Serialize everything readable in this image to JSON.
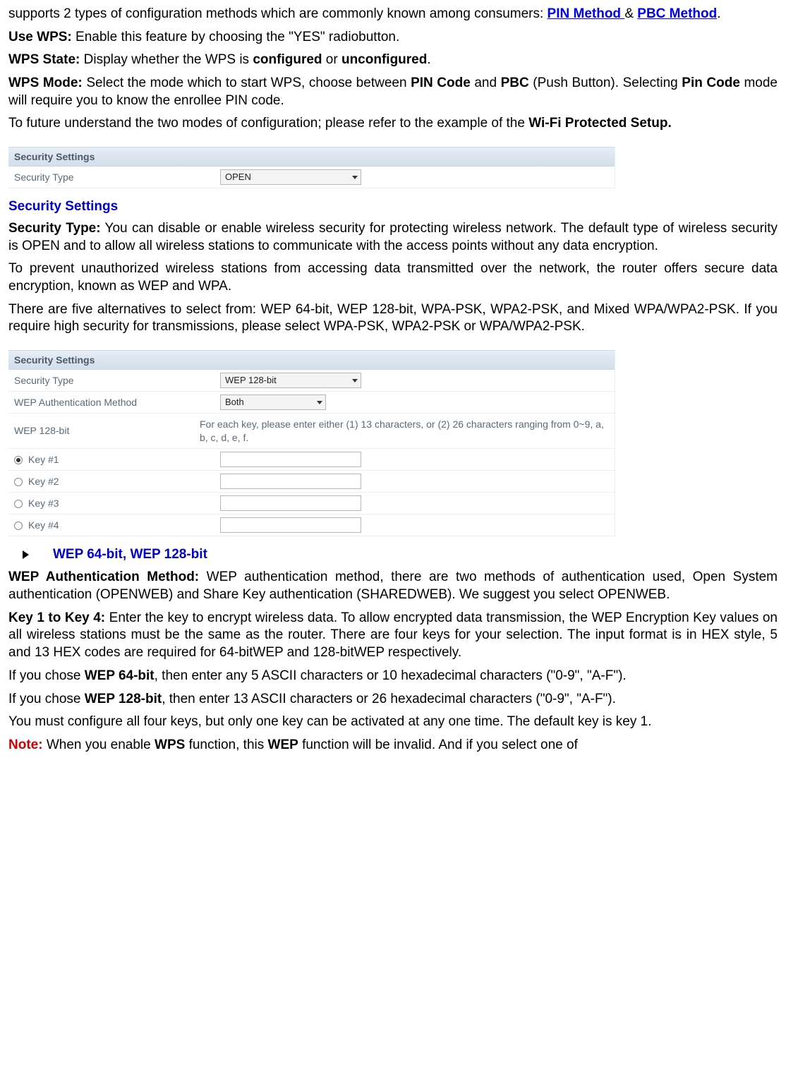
{
  "p1_a": "supports 2 types of configuration methods which are commonly known among consumers: ",
  "link_pin": "PIN Method ",
  "amp": "& ",
  "link_pbc": "PBC Method",
  "p1_end": ".",
  "p2_label": "Use WPS:",
  "p2_text": " Enable this feature by choosing the \"YES\" radiobutton.",
  "p3_label": "WPS State:",
  "p3_a": " Display whether the WPS is ",
  "p3_b": "configured",
  "p3_c": " or ",
  "p3_d": "unconfigured",
  "p3_e": ".",
  "p4_label": "WPS Mode:",
  "p4_a": " Select the mode which to start WPS, choose between ",
  "p4_b": "PIN Code",
  "p4_c": " and ",
  "p4_d": "PBC",
  "p4_e": " (Push Button). Selecting ",
  "p4_f": "Pin Code",
  "p4_g": " mode will require you to know the enrollee PIN code.",
  "p5_a": "To future understand the two modes of configuration; please refer to the example of the ",
  "p5_b": "Wi-Fi Protected Setup.",
  "ss1": {
    "header": "Security Settings",
    "row_label": "Security Type",
    "row_value": "OPEN"
  },
  "sec_title": "Security Settings",
  "sec_label": "Security Type:",
  "sec_text": " You can disable or enable wireless security for protecting wireless network. The default type of wireless security is OPEN and to allow all wireless stations to communicate with the access points without any data encryption.",
  "sec_p2": "To prevent unauthorized wireless stations from accessing data transmitted over the network, the router offers secure data encryption, known as WEP and WPA.",
  "sec_p3": "There are five alternatives to select from: WEP 64-bit, WEP 128-bit, WPA-PSK, WPA2-PSK, and Mixed WPA/WPA2-PSK. If you require high security for transmissions, please select WPA-PSK, WPA2-PSK or WPA/WPA2-PSK.",
  "ss2": {
    "header": "Security Settings",
    "r1_label": "Security Type",
    "r1_value": "WEP 128-bit",
    "r2_label": "WEP Authentication Method",
    "r2_value": "Both",
    "r3_label": "WEP 128-bit",
    "r3_text": "For each key, please enter either (1) 13 characters, or (2) 26 characters ranging from 0~9, a, b, c, d, e, f.",
    "k1": "Key #1",
    "k2": "Key #2",
    "k3": "Key #3",
    "k4": "Key #4"
  },
  "bullet": "WEP 64-bit, WEP 128-bit",
  "wep_auth_label": "WEP Authentication Method:",
  "wep_auth_text": " WEP authentication method, there are two methods of authentication used, Open System authentication (OPENWEB) and Share Key authentication (SHAREDWEB). We suggest you select OPENWEB.",
  "keys_label": "Key 1 to Key 4:",
  "keys_text": " Enter the key to encrypt wireless data. To allow encrypted data transmission, the WEP Encryption Key values on all wireless stations must be the same as the router. There are four keys for your selection. The input format is in HEX style, 5 and 13 HEX codes are required for 64-bitWEP and 128-bitWEP respectively.",
  "wep64_a": "If you chose ",
  "wep64_b": "WEP 64-bit",
  "wep64_c": ", then enter any 5 ASCII characters or 10 hexadecimal characters (\"0-9\", \"A-F\").",
  "wep128_a": "If you chose ",
  "wep128_b": "WEP 128-bit",
  "wep128_c": ", then enter 13 ASCII characters or 26 hexadecimal characters (\"0-9\", \"A-F\").",
  "fourkeys": "You must configure all four keys, but only one key can be activated at any one time. The default key is key 1.",
  "note_label": "Note:",
  "note_a": " When you enable ",
  "note_b": "WPS",
  "note_c": " function, this ",
  "note_d": "WEP",
  "note_e": " function will be invalid. And if you select one of"
}
